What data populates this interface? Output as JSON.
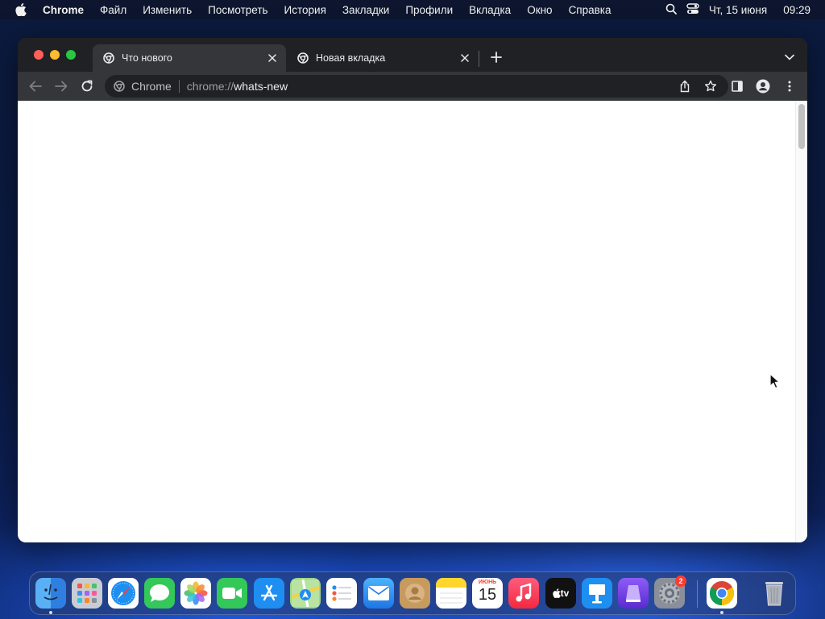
{
  "menubar": {
    "app_name": "Chrome",
    "items": [
      "Файл",
      "Изменить",
      "Посмотреть",
      "История",
      "Закладки",
      "Профили",
      "Вкладка",
      "Окно",
      "Справка"
    ],
    "date": "Чт, 15 июня",
    "time": "09:29"
  },
  "browser": {
    "tabs": [
      {
        "title": "Что нового",
        "active": true
      },
      {
        "title": "Новая вкладка",
        "active": false
      }
    ],
    "omnibox": {
      "chip": "Chrome",
      "url_scheme": "chrome://",
      "url_host": "whats-new"
    }
  },
  "dock": {
    "apps": [
      "Finder",
      "Launchpad",
      "Safari",
      "Messages",
      "Photos",
      "FaceTime",
      "App Store",
      "Maps",
      "Reminders",
      "Mail",
      "Contacts",
      "Notes",
      "Calendar",
      "Music",
      "TV",
      "Keynote",
      "Bluebook",
      "System Settings",
      "Google Chrome",
      "Trash"
    ],
    "calendar_month": "ИЮНЬ",
    "calendar_day": "15",
    "tv_label": "tv",
    "settings_badge": "2"
  },
  "colors": {
    "tab_active_bg": "#35363a",
    "window_bg": "#202124",
    "close_red": "#ff5f57",
    "minimize_yellow": "#febc2e",
    "zoom_green": "#28c840"
  }
}
